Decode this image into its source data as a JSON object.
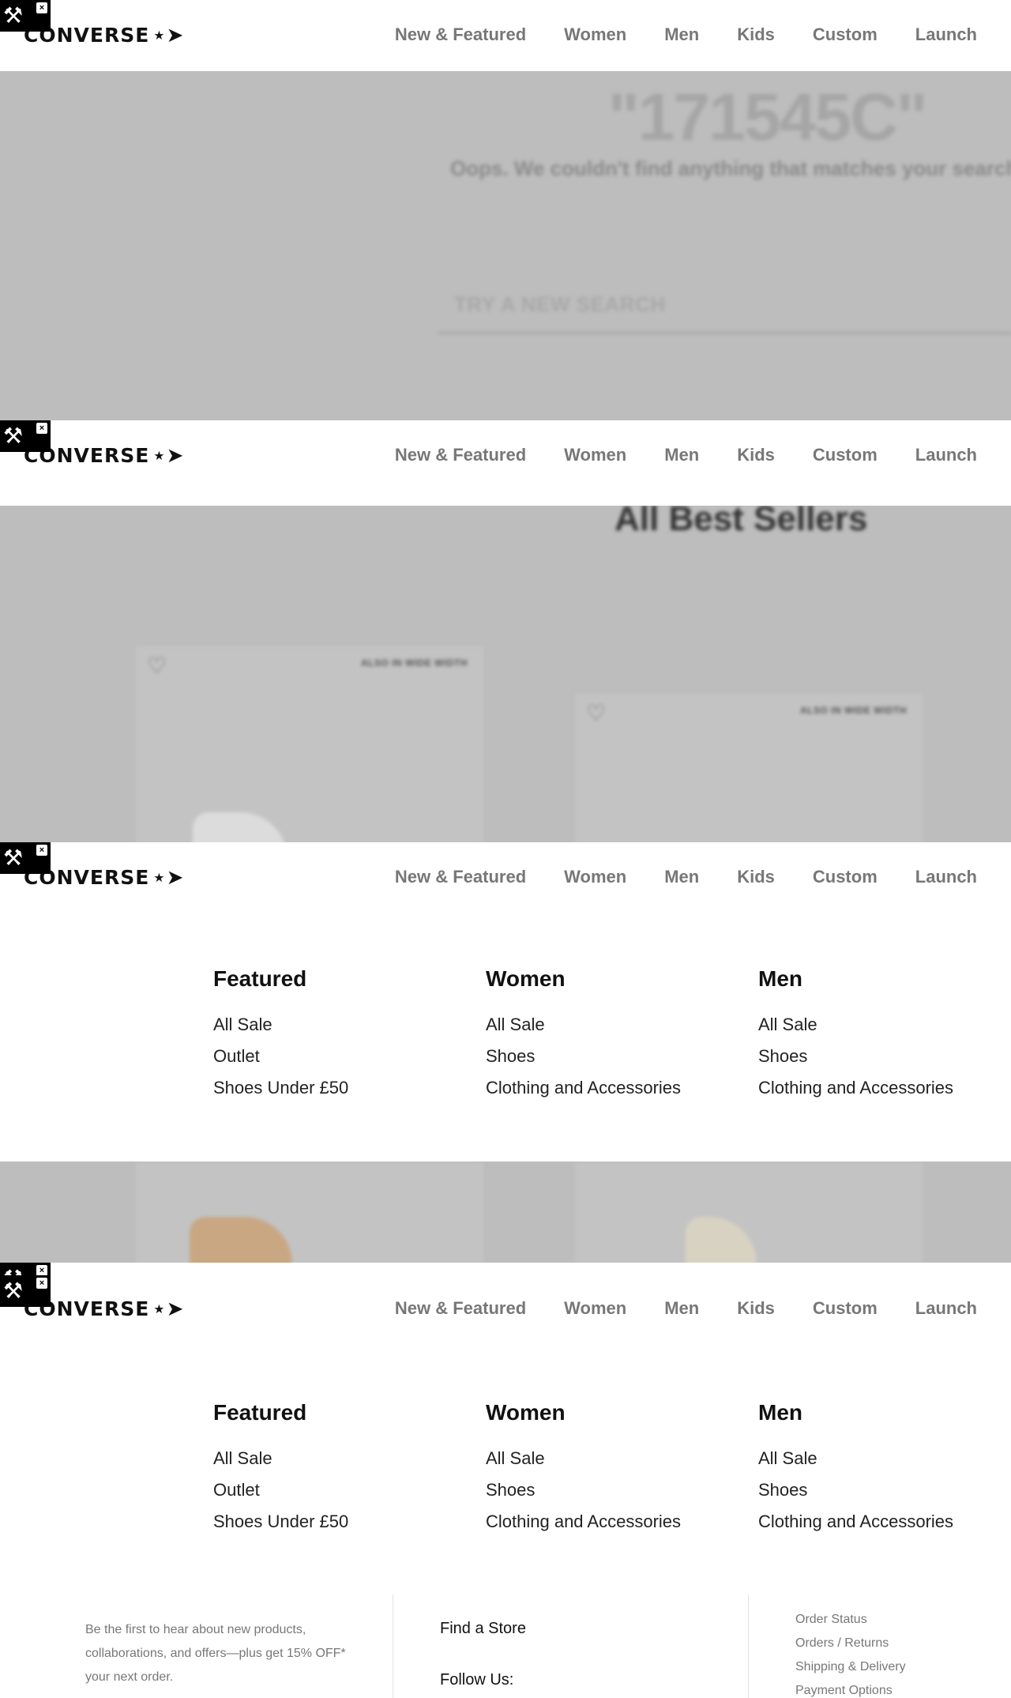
{
  "brand": {
    "logo_text": "CONVERSE",
    "logo_mark": "⋆➤"
  },
  "nav": {
    "items": [
      "New & Featured",
      "Women",
      "Men",
      "Kids",
      "Custom",
      "Launch"
    ]
  },
  "search": {
    "term": "\"171545C\"",
    "message": "Oops. We couldn't find anything that matches your search",
    "placeholder": "TRY A NEW SEARCH"
  },
  "best_sellers": {
    "title": "All Best Sellers",
    "tag": "ALSO IN WIDE WIDTH"
  },
  "menu": {
    "columns": [
      {
        "heading": "Featured",
        "links": [
          "All Sale",
          "Outlet",
          "Shoes Under £50"
        ]
      },
      {
        "heading": "Women",
        "links": [
          "All Sale",
          "Shoes",
          "Clothing and Accessories"
        ]
      },
      {
        "heading": "Men",
        "links": [
          "All Sale",
          "Shoes",
          "Clothing and Accessories"
        ]
      }
    ]
  },
  "footer": {
    "promo": "Be the first to hear about new products, collaborations, and offers—plus get 15% OFF* your next order.",
    "find_store": "Find a Store",
    "follow_us": "Follow Us:",
    "help_links": [
      "Order Status",
      "Orders / Returns",
      "Shipping & Delivery",
      "Payment Options"
    ]
  },
  "icons": {
    "tool": "tools-icon",
    "close": "close-icon",
    "heart": "heart-icon"
  },
  "colors": {
    "overlay_gray": "#bdbdbd",
    "nav_text": "#777777",
    "tool_badge": "#000000"
  }
}
